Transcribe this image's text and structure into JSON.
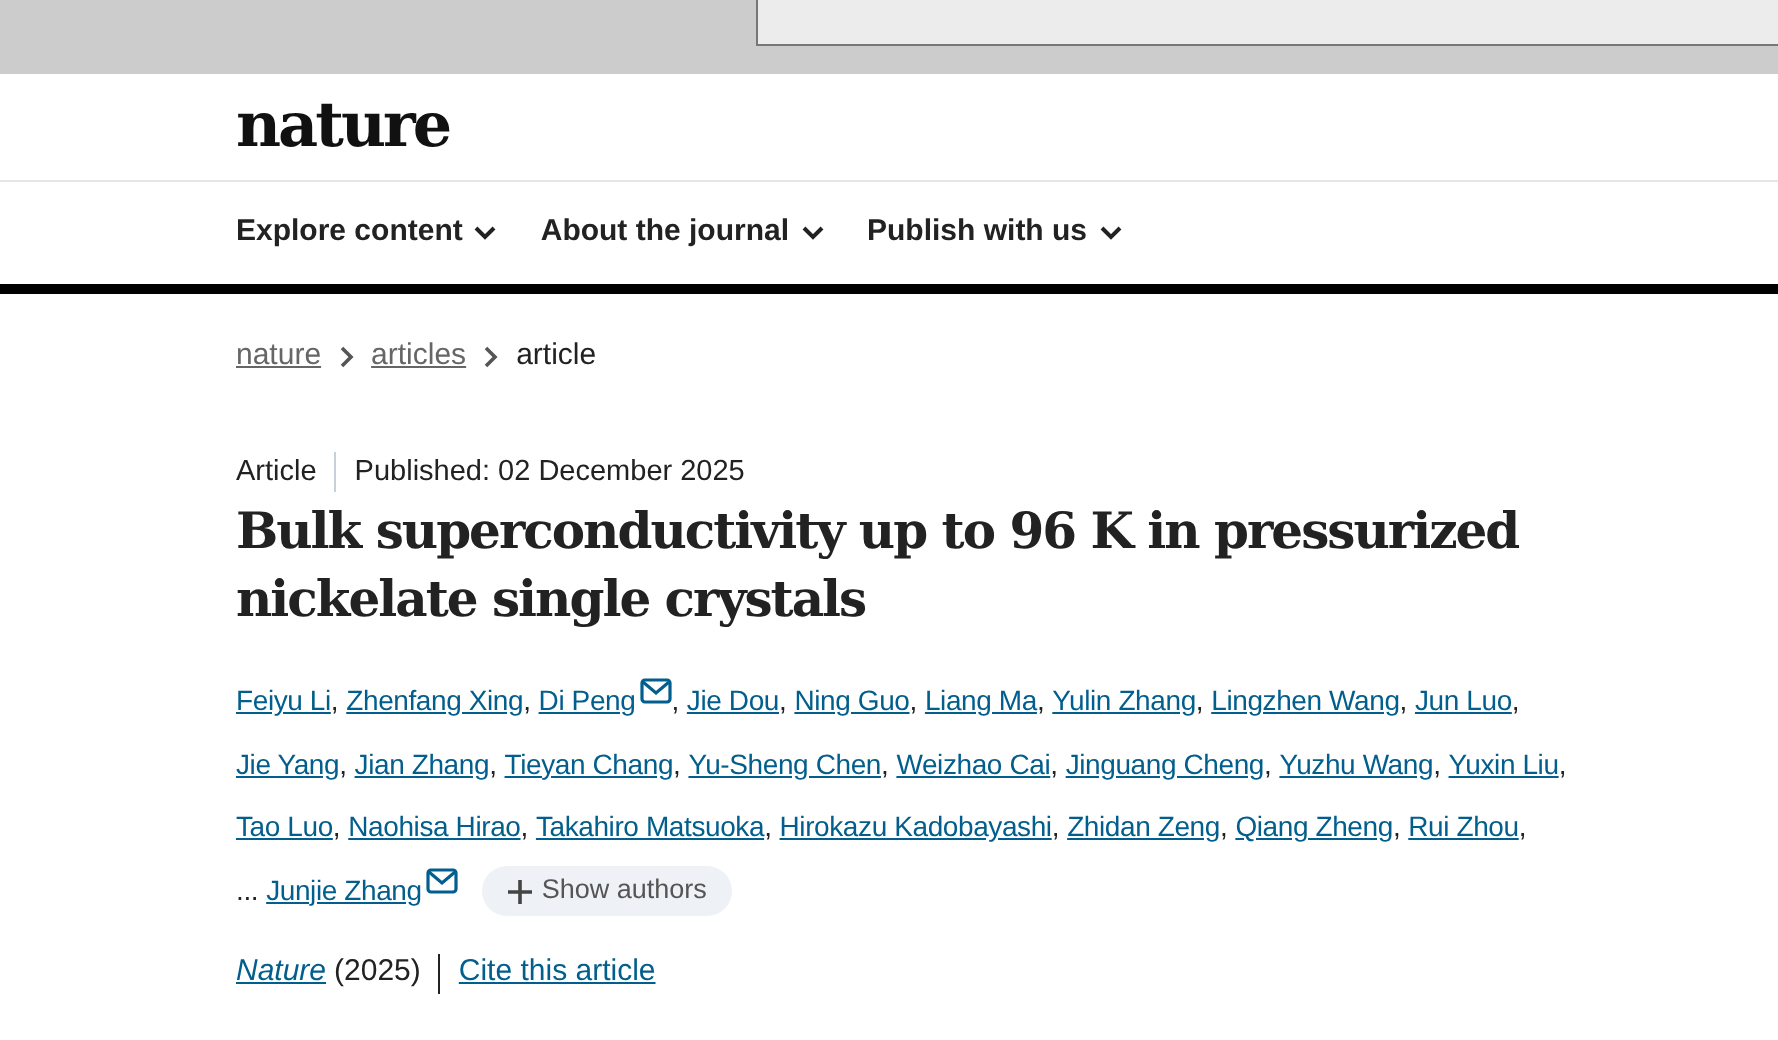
{
  "logo": "nature",
  "nav": [
    {
      "label": "Explore content"
    },
    {
      "label": "About the journal"
    },
    {
      "label": "Publish with us"
    }
  ],
  "breadcrumb": [
    {
      "label": "nature",
      "link": true
    },
    {
      "label": "articles",
      "link": true
    },
    {
      "label": "article",
      "link": false
    }
  ],
  "article_type": "Article",
  "published": "Published: 02 December 2025",
  "title": "Bulk superconductivity up to 96 K in pressurized nickelate single crystals",
  "author_lines": [
    [
      {
        "name": "Feiyu Li",
        "mail": false,
        "suffix": ","
      },
      {
        "name": "Zhenfang Xing",
        "mail": false,
        "suffix": ","
      },
      {
        "name": "Di Peng",
        "mail": true,
        "suffix": ","
      },
      {
        "name": "Jie Dou",
        "mail": false,
        "suffix": ","
      },
      {
        "name": "Ning Guo",
        "mail": false,
        "suffix": ","
      },
      {
        "name": "Liang Ma",
        "mail": false,
        "suffix": ","
      },
      {
        "name": "Yulin Zhang",
        "mail": false,
        "suffix": ","
      },
      {
        "name": "Lingzhen Wang",
        "mail": false,
        "suffix": ","
      },
      {
        "name": "Jun Luo",
        "mail": false,
        "suffix": ","
      }
    ],
    [
      {
        "name": "Jie Yang",
        "mail": false,
        "suffix": ","
      },
      {
        "name": "Jian Zhang",
        "mail": false,
        "suffix": ","
      },
      {
        "name": "Tieyan Chang",
        "mail": false,
        "suffix": ","
      },
      {
        "name": "Yu-Sheng Chen",
        "mail": false,
        "suffix": ","
      },
      {
        "name": "Weizhao Cai",
        "mail": false,
        "suffix": ","
      },
      {
        "name": "Jinguang Cheng",
        "mail": false,
        "suffix": ","
      },
      {
        "name": "Yuzhu Wang",
        "mail": false,
        "suffix": ","
      },
      {
        "name": "Yuxin Liu",
        "mail": false,
        "suffix": ","
      }
    ],
    [
      {
        "name": "Tao Luo",
        "mail": false,
        "suffix": ","
      },
      {
        "name": "Naohisa Hirao",
        "mail": false,
        "suffix": ","
      },
      {
        "name": "Takahiro Matsuoka",
        "mail": false,
        "suffix": ","
      },
      {
        "name": "Hirokazu Kadobayashi",
        "mail": false,
        "suffix": ","
      },
      {
        "name": "Zhidan Zeng",
        "mail": false,
        "suffix": ","
      },
      {
        "name": "Qiang Zheng",
        "mail": false,
        "suffix": ","
      },
      {
        "name": "Rui Zhou",
        "mail": false,
        "suffix": ","
      }
    ],
    [
      {
        "prefix": "...",
        "name": "Junjie Zhang",
        "mail": true
      }
    ]
  ],
  "show_authors": "Show authors",
  "journal": "Nature",
  "year": "(2025)",
  "cite": "Cite this article"
}
